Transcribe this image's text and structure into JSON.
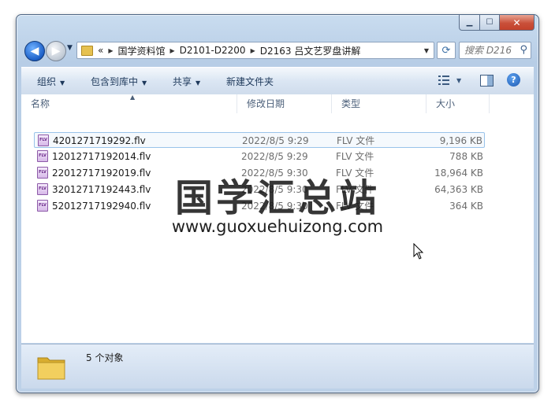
{
  "window": {
    "caption_buttons": {
      "minimize": "▁",
      "maximize": "☐",
      "close": "✕"
    }
  },
  "nav": {
    "back_glyph": "◀",
    "forward_glyph": "▶",
    "history_glyph": "▼",
    "breadcrumb": {
      "overflow": "«",
      "items": [
        "国学资料馆",
        "D2101-D2200",
        "D2163 吕文艺罗盘讲解"
      ]
    },
    "refresh_glyph": "⟳",
    "search_placeholder": "搜索 D216..."
  },
  "toolbar": {
    "organize": "组织",
    "include_in_library": "包含到库中",
    "share": "共享",
    "new_folder": "新建文件夹",
    "help": "?"
  },
  "columns": {
    "name": "名称",
    "date": "修改日期",
    "type": "类型",
    "size": "大小"
  },
  "files": [
    {
      "name": "4201271719292.flv",
      "date": "2022/8/5 9:29",
      "type": "FLV 文件",
      "size": "9,196 KB",
      "icon_label": "FLV"
    },
    {
      "name": "12012717192014.flv",
      "date": "2022/8/5 9:29",
      "type": "FLV 文件",
      "size": "788 KB",
      "icon_label": "FLV"
    },
    {
      "name": "22012717192019.flv",
      "date": "2022/8/5 9:30",
      "type": "FLV 文件",
      "size": "18,964 KB",
      "icon_label": "FLV"
    },
    {
      "name": "32012717192443.flv",
      "date": "2022/8/5 9:30",
      "type": "FLV 文件",
      "size": "64,363 KB",
      "icon_label": "FLV"
    },
    {
      "name": "52012717192940.flv",
      "date": "2022/8/5 9:30",
      "type": "FLV 文件",
      "size": "364 KB",
      "icon_label": "FLV"
    }
  ],
  "status": {
    "count_text": "5 个对象"
  },
  "watermark": {
    "title": "国学汇总站",
    "url": "www.guoxuehuizong.com"
  },
  "colors": {
    "frame": "#bdd1e8",
    "accent": "#1c5fc7",
    "close": "#c9503a",
    "flv_icon": "#8d5aa8",
    "folder": "#e6c150"
  }
}
